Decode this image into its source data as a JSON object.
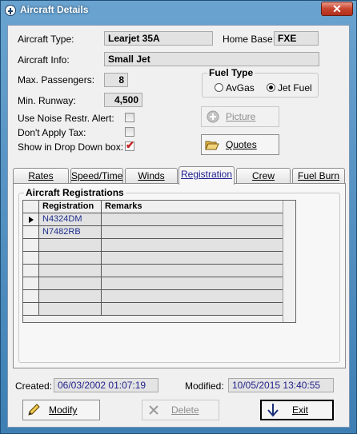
{
  "window": {
    "title": "Aircraft Details",
    "close_glyph": "✕"
  },
  "form": {
    "aircraft_type_label": "Aircraft Type:",
    "aircraft_type": "Learjet 35A",
    "home_base_label": "Home Base:",
    "home_base": "FXE",
    "aircraft_info_label": "Aircraft Info:",
    "aircraft_info": "Small Jet",
    "max_passengers_label": "Max. Passengers:",
    "max_passengers": "8",
    "min_runway_label": "Min. Runway:",
    "min_runway": "4,500",
    "noise_label": "Use Noise Restr. Alert:",
    "noise_checked": false,
    "tax_label": "Don't Apply Tax:",
    "tax_checked": false,
    "dropdown_label": "Show in Drop Down box:",
    "dropdown_checked": true
  },
  "fuel": {
    "legend": "Fuel Type",
    "options": [
      {
        "label": "AvGas",
        "selected": false
      },
      {
        "label": "Jet Fuel",
        "selected": true
      }
    ]
  },
  "buttons": {
    "picture": "Picture",
    "quotes": "Quotes",
    "modify": "Modify",
    "delete": "Delete",
    "exit": "Exit"
  },
  "tabs": [
    {
      "label": "Rates",
      "active": false
    },
    {
      "label": "Speed/Time",
      "active": false
    },
    {
      "label": "Winds",
      "active": false
    },
    {
      "label": "Registration",
      "active": true
    },
    {
      "label": "Crew",
      "active": false
    },
    {
      "label": "Fuel Burn",
      "active": false
    }
  ],
  "registrations": {
    "legend": "Aircraft Registrations",
    "columns": [
      "Registration",
      "Remarks"
    ],
    "rows": [
      {
        "registration": "N4324DM",
        "remarks": "",
        "current": true
      },
      {
        "registration": "N7482RB",
        "remarks": "",
        "current": false
      },
      {
        "registration": "",
        "remarks": "",
        "current": false
      },
      {
        "registration": "",
        "remarks": "",
        "current": false
      },
      {
        "registration": "",
        "remarks": "",
        "current": false
      },
      {
        "registration": "",
        "remarks": "",
        "current": false
      },
      {
        "registration": "",
        "remarks": "",
        "current": false
      },
      {
        "registration": "",
        "remarks": "",
        "current": false
      }
    ]
  },
  "footer": {
    "created_label": "Created:",
    "created": "06/03/2002 01:07:19",
    "modified_label": "Modified:",
    "modified": "10/05/2015 13:40:55"
  },
  "colors": {
    "title_bar": "#3d7fb3",
    "close_button": "#c7442e",
    "link_blue": "#1d2f8c",
    "check_red": "#c81e1e"
  }
}
